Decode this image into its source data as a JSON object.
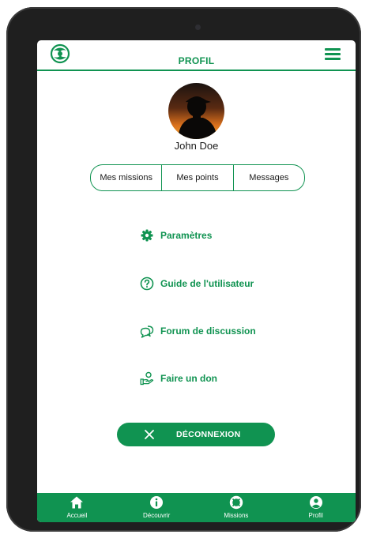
{
  "header": {
    "title": "PROFIL",
    "logo_icon": "leaf-globe-logo",
    "menu_icon": "hamburger-menu-icon"
  },
  "profile": {
    "name": "John Doe"
  },
  "tabs": [
    {
      "label": "Mes missions"
    },
    {
      "label": "Mes points"
    },
    {
      "label": "Messages"
    }
  ],
  "menu": [
    {
      "label": "Paramètres",
      "icon": "gear-icon"
    },
    {
      "label": "Guide de l'utilisateur",
      "icon": "help-circle-icon"
    },
    {
      "label": "Forum de discussion",
      "icon": "chat-bubbles-icon"
    },
    {
      "label": "Faire un don",
      "icon": "donate-hand-icon"
    }
  ],
  "logout": {
    "label": "DÉCONNEXION",
    "icon": "close-icon"
  },
  "bottom_nav": [
    {
      "label": "Accueil",
      "icon": "home-icon"
    },
    {
      "label": "Découvrir",
      "icon": "info-icon"
    },
    {
      "label": "Missions",
      "icon": "lifebuoy-icon"
    },
    {
      "label": "Profil",
      "icon": "user-icon"
    }
  ],
  "colors": {
    "brand_green": "#109351",
    "frame": "#1f1f1f",
    "text": "#1a1a1a"
  }
}
